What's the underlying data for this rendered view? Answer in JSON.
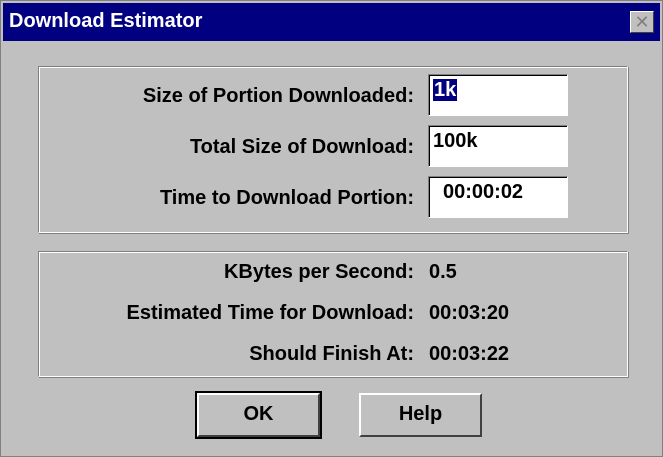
{
  "window": {
    "title": "Download Estimator",
    "close_glyph": "✕"
  },
  "inputs": {
    "portion_label": "Size of Portion Downloaded:",
    "portion_value_selected": "1k",
    "total_label": "Total Size of Download:",
    "total_value": "100k",
    "time_label": "Time to Download Portion:",
    "time_value": "00:00:02"
  },
  "results": {
    "kbps_label": "KBytes per Second:",
    "kbps_value": "0.5",
    "est_label": "Estimated Time for Download:",
    "est_value": "00:03:20",
    "finish_label": "Should Finish At:",
    "finish_value": "00:03:22"
  },
  "buttons": {
    "ok": "OK",
    "help": "Help"
  },
  "colors": {
    "titlebar": "#000080",
    "face": "#c0c0c0"
  }
}
